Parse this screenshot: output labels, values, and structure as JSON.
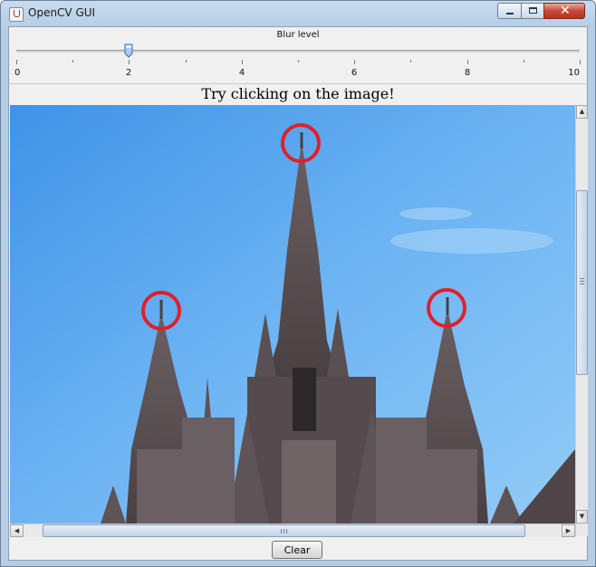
{
  "window": {
    "title": "OpenCV GUI"
  },
  "slider": {
    "label": "Blur level",
    "min": 0,
    "max": 10,
    "value": 2,
    "tick_labels": [
      "0",
      "2",
      "4",
      "6",
      "8",
      "10"
    ]
  },
  "caption": "Try clicking on the image!",
  "image": {
    "subject": "Gothic cathedral spires against blue sky",
    "markers": 3,
    "marker_color": "#e0202a"
  },
  "scrollbars": {
    "vertical_position": 0.1,
    "horizontal_position": 0.5
  },
  "buttons": {
    "clear_label": "Clear"
  },
  "colors": {
    "sky": "#6fb6f2",
    "marker": "#e0202a",
    "thumb": "#7fb4e8"
  }
}
